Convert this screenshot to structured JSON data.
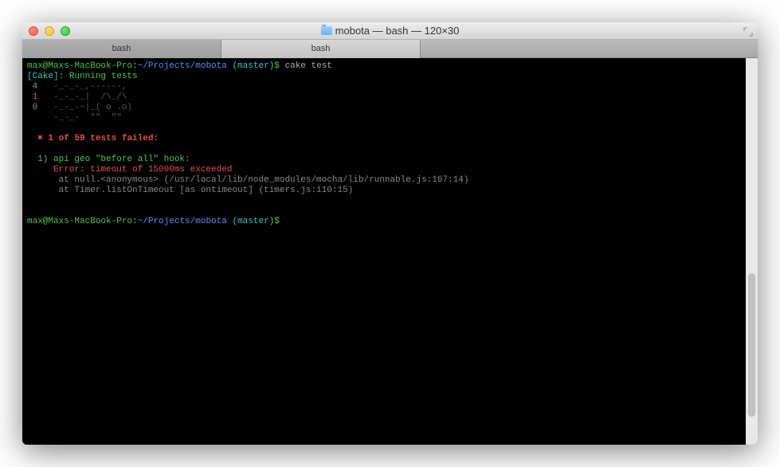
{
  "window": {
    "title": "mobota — bash — 120×30"
  },
  "tabs": [
    {
      "label": "bash",
      "active": false
    },
    {
      "label": "bash",
      "active": true
    }
  ],
  "prompt": {
    "userHost": "max@Maxs-MacBook-Pro",
    "sep1": ":",
    "path": "~/Projects/mobota",
    "branch": " (master)",
    "sigil": "$",
    "cmd": " cake test"
  },
  "out": {
    "cakeLabel": "[Cake]:",
    "cakeMsg": " Running tests",
    "nyan4": " 4  ",
    "nyan4art": " -_-_-_,------,",
    "nyan1": " 1  ",
    "nyan1art": " -_-_-_|  /\\_/\\",
    "nyan0": " 0  ",
    "nyan0art": " -_-_-~|_( o .o)",
    "nyanBlank": "    ",
    "nyanTail": " -_-_-  \"\"  \"\"",
    "failMark": "  ✖",
    "failMsg": " 1 of 59 tests failed:",
    "testTitle": "  1) api geo \"before all\" hook:",
    "errMsg": "     Error: timeout of 15000ms exceeded",
    "trace1": "      at null.<anonymous> (/usr/local/lib/node_modules/mocha/lib/runnable.js:167:14)",
    "trace2": "      at Timer.listOnTimeout [as ontimeout] (timers.js:110:15)"
  },
  "prompt2": {
    "userHost": "max@Maxs-MacBook-Pro",
    "sep1": ":",
    "path": "~/Projects/mobota",
    "branch": " (master)",
    "sigil": "$"
  }
}
